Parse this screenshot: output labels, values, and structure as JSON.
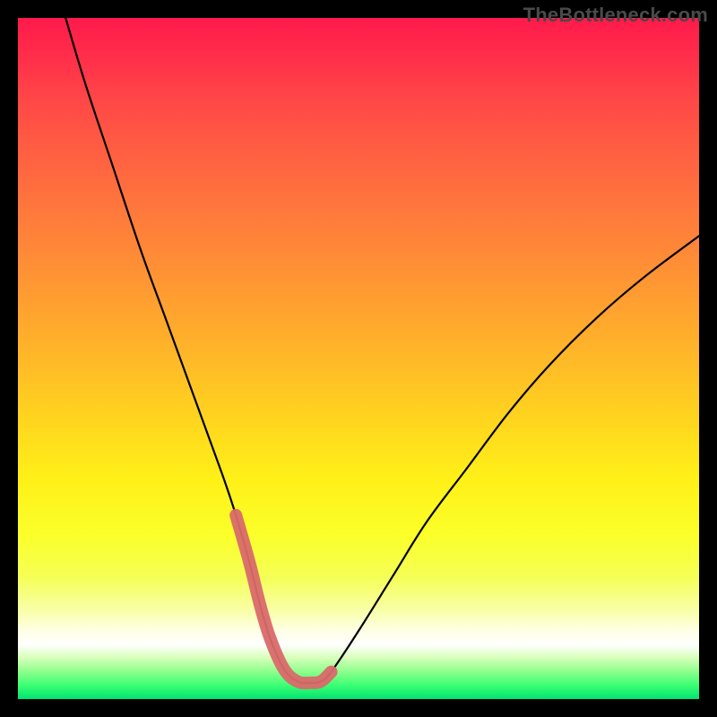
{
  "watermark": "TheBottleneck.com",
  "chart_data": {
    "type": "line",
    "title": "",
    "xlabel": "",
    "ylabel": "",
    "xlim": [
      0,
      100
    ],
    "ylim": [
      0,
      100
    ],
    "grid": false,
    "legend": false,
    "series": [
      {
        "name": "bottleneck-curve",
        "x": [
          7,
          10,
          14,
          18,
          22,
          26,
          30,
          32,
          34,
          35.5,
          37,
          39,
          41,
          43,
          44.5,
          46,
          50,
          55,
          60,
          66,
          72,
          78,
          85,
          92,
          100
        ],
        "values": [
          100,
          90,
          78,
          66,
          55,
          44,
          33,
          27,
          20,
          14,
          9,
          4.5,
          2.6,
          2.4,
          2.6,
          4,
          10,
          18,
          26,
          34,
          42,
          49,
          56,
          62,
          68
        ]
      },
      {
        "name": "valley-highlight",
        "x": [
          32,
          34,
          35.5,
          37,
          39,
          41,
          43,
          44.5,
          46
        ],
        "values": [
          27,
          20,
          14,
          9,
          4.5,
          2.6,
          2.4,
          2.6,
          4
        ]
      }
    ],
    "colors": {
      "curve": "#000000",
      "highlight": "#d96a6a",
      "gradient_top": "#ff1a4b",
      "gradient_bottom": "#00e371"
    }
  }
}
